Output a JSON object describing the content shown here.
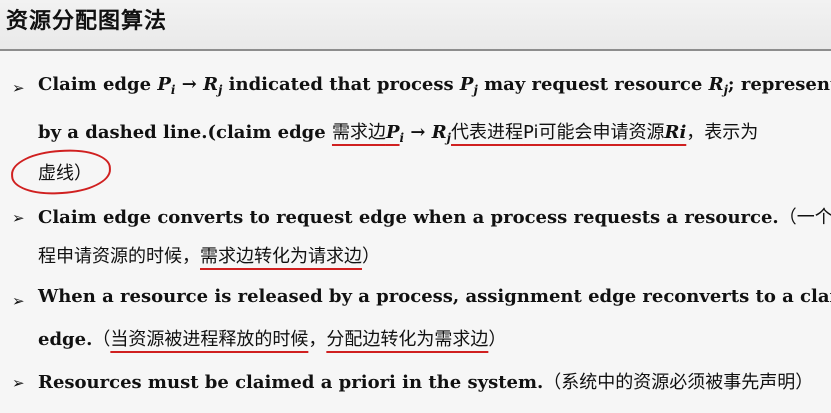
{
  "slide": {
    "title": "资源分配图算法",
    "bullet_symbol": "➢",
    "bullets": [
      {
        "l1_a": "Claim edge ",
        "l1_pi": "P",
        "l1_i": "i",
        "l1_arrow": " → ",
        "l1_rj": "R",
        "l1_j": "j",
        "l1_b": " indicated that process ",
        "l1_pj": "P",
        "l1_pj_sub": "j",
        "l1_c": " may request resource ",
        "l1_rj2": "R",
        "l1_rj2_sub": "j",
        "l1_d": "; represented",
        "l2_a": "by a dashed line.(claim edge ",
        "l2_cn1": "需求边",
        "l2_pi": "P",
        "l2_i": "i",
        "l2_arrow": " → ",
        "l2_rj": "R",
        "l2_j": "j",
        "l2_cn2": "代表进程",
        "l2_cn3": "Pi可能会申请资源",
        "l2_ri": "Ri",
        "l2_cn4": "，表示为",
        "l3": "虚线）"
      },
      {
        "l1_a": "Claim edge converts to request edge when a process requests a resource.",
        "l1_cn": "（一个进",
        "l2_a": "程申请资源的时候，",
        "l2_b": "需求边转化为请求边",
        "l2_c": "）"
      },
      {
        "l1": "When a resource is released by a process, assignment edge reconverts to a claim",
        "l2_a": "edge.",
        "l2_b": "（",
        "l2_c": "当资源被进程释放的时候",
        "l2_d": "，",
        "l2_e": "分配边转化为需求边",
        "l2_f": "）"
      },
      {
        "l1_a": "Resources must be claimed a priori in the system.",
        "l1_b": "（系统中的资源必须被事先声明）"
      }
    ]
  }
}
